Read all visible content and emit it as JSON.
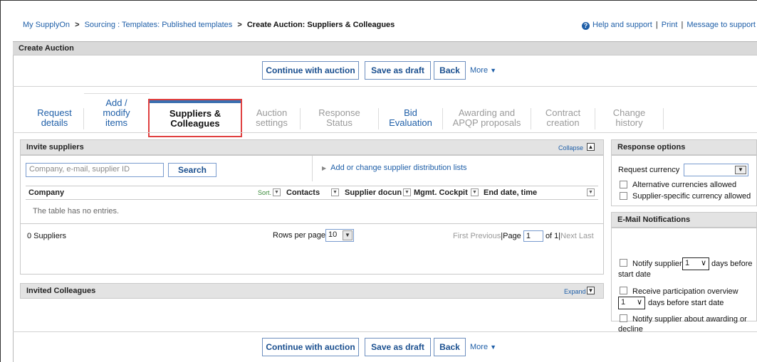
{
  "breadcrumb": {
    "items": [
      "My SupplyOn",
      "Sourcing : Templates: Published templates"
    ],
    "current": "Create Auction: Suppliers & Colleagues",
    "sep": ">"
  },
  "toplinks": {
    "help": "Help and support",
    "print": "Print",
    "message": "Message to support",
    "pipe": "|",
    "help_glyph": "?"
  },
  "page_title": "Create Auction",
  "actions": {
    "continue": "Continue with auction",
    "save_draft": "Save as draft",
    "back": "Back",
    "more": "More"
  },
  "tabs": [
    {
      "line1": "Request",
      "line2": "details",
      "line0": ""
    },
    {
      "line0": "Add /",
      "line1": "modify",
      "line2": "items"
    },
    {
      "line1": "Suppliers &",
      "line2": "Colleagues"
    },
    {
      "line1": "Auction",
      "line2": "settings"
    },
    {
      "line1": "Response",
      "line2": "Status"
    },
    {
      "line1": "Bid",
      "line2": "Evaluation"
    },
    {
      "line1": "Awarding and",
      "line2": "APQP proposals"
    },
    {
      "line1": "Contract",
      "line2": "creation"
    },
    {
      "line1": "Change",
      "line2": "history"
    }
  ],
  "invite": {
    "title": "Invite suppliers",
    "collapse": "Collapse",
    "search_placeholder": "Company, e-mail, supplier ID",
    "search_button": "Search",
    "dist_link": "Add or change supplier distribution lists",
    "columns": [
      "Company",
      "Contacts",
      "Supplier docun",
      "Mgmt. Cockpit",
      "End date, time"
    ],
    "sort": "Sort.",
    "empty": "The table has no entries.",
    "count": "0 Suppliers",
    "rows_per_page_label": "Rows per page",
    "rows_per_page": "10",
    "pager": {
      "first": "First",
      "previous": "Previous",
      "page_label": "Page",
      "page": "1",
      "of": "of 1",
      "next": "Next",
      "last": "Last",
      "pipe": "|"
    }
  },
  "colleagues": {
    "title": "Invited Colleagues",
    "expand": "Expand"
  },
  "response_options": {
    "title": "Response options",
    "currency_label": "Request currency",
    "currency_value": "",
    "alt_currencies": "Alternative currencies allowed",
    "supplier_currency": "Supplier-specific currency allowed"
  },
  "email": {
    "title": "E-Mail Notifications",
    "notify_prefix": "Notify supplier",
    "notify_value": "1",
    "notify_suffix": "days before",
    "notify_suffix2": "start date",
    "participation_line1": "Receive participation overview",
    "participation_value": "1",
    "participation_suffix": "days before start date",
    "awarding_line1": "Notify supplier about awarding or",
    "awarding_line2": "decline"
  }
}
